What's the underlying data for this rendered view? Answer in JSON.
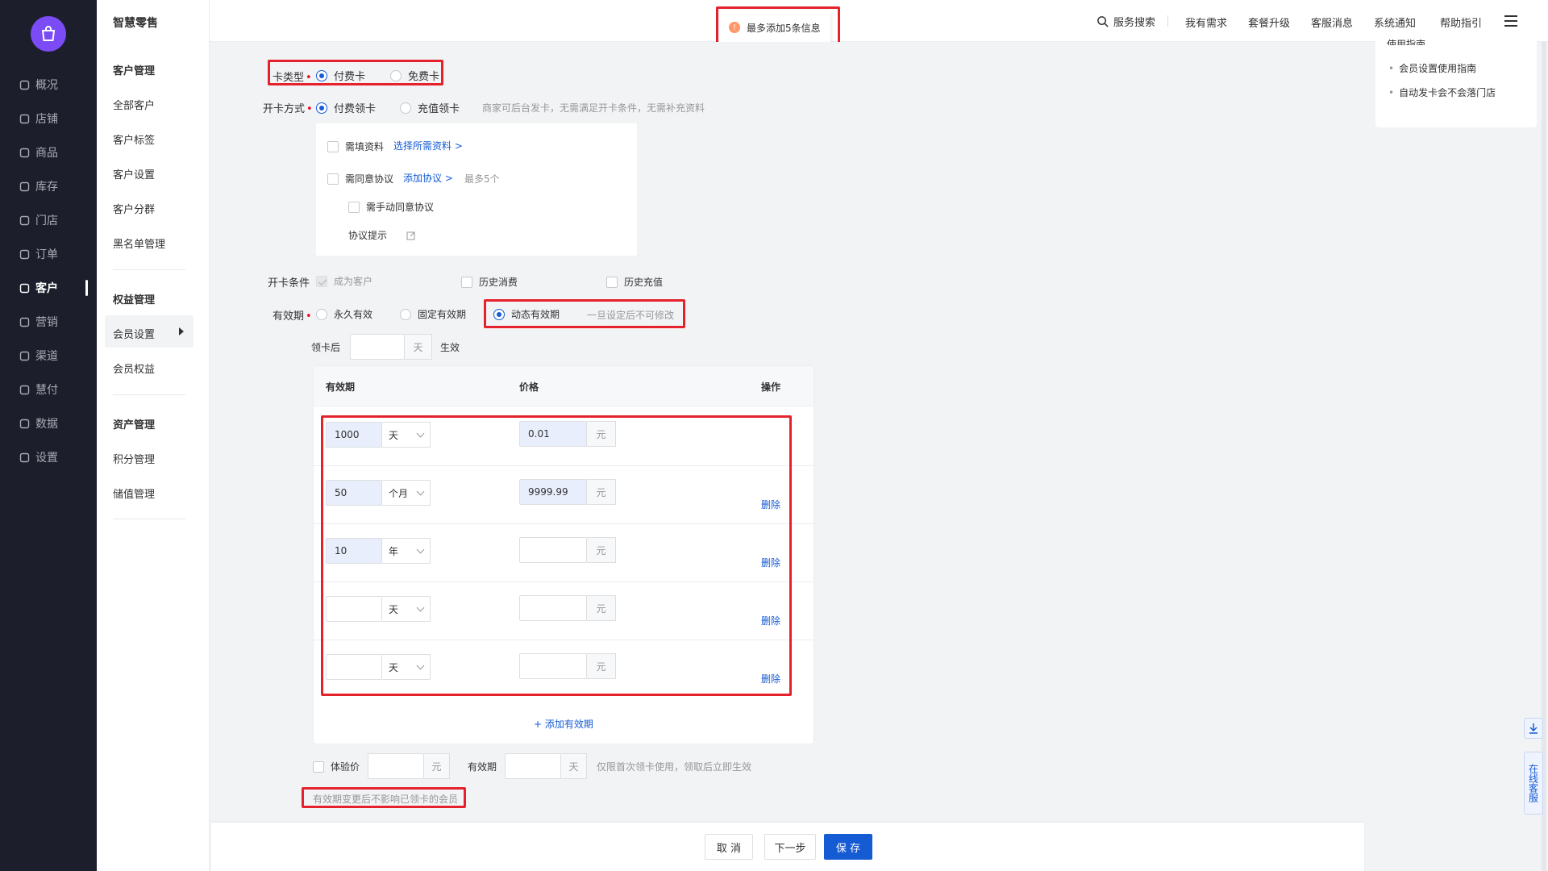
{
  "app": {
    "title": "智慧零售"
  },
  "nav1": [
    {
      "label": "概况",
      "icon": "overview-icon"
    },
    {
      "label": "店铺",
      "icon": "shop-icon"
    },
    {
      "label": "商品",
      "icon": "goods-icon"
    },
    {
      "label": "库存",
      "icon": "inventory-icon"
    },
    {
      "label": "门店",
      "icon": "store-icon"
    },
    {
      "label": "订单",
      "icon": "order-icon"
    },
    {
      "label": "客户",
      "icon": "customer-icon"
    },
    {
      "label": "营销",
      "icon": "marketing-icon"
    },
    {
      "label": "渠道",
      "icon": "channel-icon"
    },
    {
      "label": "慧付",
      "icon": "pay-icon"
    },
    {
      "label": "数据",
      "icon": "data-icon"
    },
    {
      "label": "设置",
      "icon": "settings-icon"
    }
  ],
  "nav2": {
    "group1": "客户管理",
    "items1": [
      "全部客户",
      "客户标签",
      "客户设置",
      "客户分群",
      "黑名单管理"
    ],
    "group2": "权益管理",
    "items2": [
      "会员设置",
      "会员权益"
    ],
    "group3": "资产管理",
    "items3": [
      "积分管理",
      "储值管理"
    ]
  },
  "topbar": {
    "search": "服务搜索",
    "items": [
      "我有需求",
      "套餐升级",
      "客服消息",
      "系统通知",
      "帮助指引"
    ]
  },
  "toast": {
    "text": "最多添加5条信息"
  },
  "form": {
    "card_type_label": "卡类型",
    "card_type_opts": [
      "付费卡",
      "免费卡"
    ],
    "open_method_label": "开卡方式",
    "open_method_opts": [
      "付费领卡",
      "充值领卡"
    ],
    "open_method_hint": "商家可后台发卡，无需满足开卡条件，无需补充资料",
    "need_info": "需填资料",
    "select_info": "选择所需资料 >",
    "need_agree": "需同意协议",
    "add_agreement": "添加协议 >",
    "max5": "最多5个",
    "manual_agree": "需手动同意协议",
    "agree_tip": "协议提示",
    "cond_label": "开卡条件",
    "cond_opts": [
      "成为客户",
      "历史消费",
      "历史充值"
    ],
    "validity_label": "有效期",
    "validity_opts": [
      "永久有效",
      "固定有效期",
      "动态有效期"
    ],
    "validity_hint": "一旦设定后不可修改",
    "after_get": "领卡后",
    "day": "天",
    "effective": "生效"
  },
  "table": {
    "headers": [
      "有效期",
      "价格",
      "操作"
    ],
    "rows": [
      {
        "period": "1000",
        "unit": "天",
        "price": "0.01",
        "currency": "元",
        "del": ""
      },
      {
        "period": "50",
        "unit": "个月",
        "price": "9999.99",
        "currency": "元",
        "del": "删除"
      },
      {
        "period": "10",
        "unit": "年",
        "price": "",
        "currency": "元",
        "del": "删除"
      },
      {
        "period": "",
        "unit": "天",
        "price": "",
        "currency": "元",
        "del": "删除"
      },
      {
        "period": "",
        "unit": "天",
        "price": "",
        "currency": "元",
        "del": "删除"
      }
    ],
    "add": "+ 添加有效期"
  },
  "trial": {
    "label": "体验价",
    "currency": "元",
    "period_label": "有效期",
    "day": "天",
    "hint": "仅限首次领卡使用，领取后立即生效"
  },
  "note": "有效期变更后不影响已领卡的会员",
  "footer": {
    "cancel": "取 消",
    "next": "下一步",
    "save": "保 存"
  },
  "right": {
    "title": "使用指南",
    "links": [
      "会员设置使用指南",
      "自动发卡会不会落门店"
    ]
  },
  "float": {
    "service": "在线客服"
  }
}
